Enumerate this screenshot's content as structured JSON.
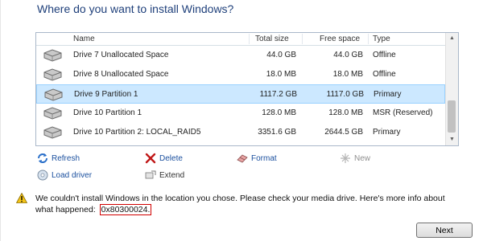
{
  "title": "Where do you want to install Windows?",
  "columns": {
    "name": "Name",
    "total": "Total size",
    "free": "Free space",
    "type": "Type"
  },
  "drives": [
    {
      "name": "Drive 7 Unallocated Space",
      "total": "44.0 GB",
      "free": "44.0 GB",
      "type": "Offline",
      "selected": false
    },
    {
      "name": "Drive 8 Unallocated Space",
      "total": "18.0 MB",
      "free": "18.0 MB",
      "type": "Offline",
      "selected": false
    },
    {
      "name": "Drive 9 Partition 1",
      "total": "1117.2 GB",
      "free": "1117.0 GB",
      "type": "Primary",
      "selected": true
    },
    {
      "name": "Drive 10 Partition 1",
      "total": "128.0 MB",
      "free": "128.0 MB",
      "type": "MSR (Reserved)",
      "selected": false
    },
    {
      "name": "Drive 10 Partition 2: LOCAL_RAID5",
      "total": "3351.6 GB",
      "free": "2644.5 GB",
      "type": "Primary",
      "selected": false
    }
  ],
  "actions": {
    "refresh": "Refresh",
    "delete": "Delete",
    "format": "Format",
    "new": "New",
    "load_driver": "Load driver",
    "extend": "Extend"
  },
  "message": {
    "text": "We couldn't install Windows in the location you chose. Please check your media drive. Here's more info about what happened:",
    "code": "0x80300024."
  },
  "next_label": "Next",
  "colors": {
    "title": "#1e3f7a",
    "link": "#1a4f9e",
    "selected_row": "#cce8ff",
    "error_highlight": "#d00000"
  }
}
